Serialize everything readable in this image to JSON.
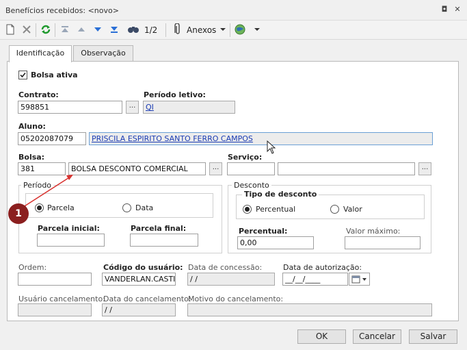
{
  "window": {
    "title": "Benefícios recebidos: <novo>",
    "controls": {
      "restore": "◘",
      "close": "✕"
    }
  },
  "toolbar": {
    "record_position": "1/2",
    "attachments_label": "Anexos"
  },
  "tabs": [
    {
      "label": "Identificação"
    },
    {
      "label": "Observação"
    }
  ],
  "form": {
    "bolsa_ativa_label": "Bolsa ativa",
    "contrato": {
      "label": "Contrato:",
      "value": "598851"
    },
    "periodo_letivo": {
      "label": "Período letivo:",
      "value": "QI"
    },
    "aluno": {
      "label": "Aluno:",
      "code": "05202087079",
      "name": "PRISCILA ESPIRITO SANTO FERRO CAMPOS"
    },
    "bolsa": {
      "label": "Bolsa:",
      "code": "381",
      "name": "BOLSA DESCONTO COMERCIAL"
    },
    "servico": {
      "label": "Serviço:",
      "code": "",
      "name": ""
    },
    "periodo_group": {
      "label": "Período",
      "option_parcela": "Parcela",
      "option_data": "Data",
      "parcela_inicial_label": "Parcela inicial:",
      "parcela_final_label": "Parcela final:",
      "parcela_inicial_value": "",
      "parcela_final_value": ""
    },
    "desconto_group": {
      "label": "Desconto",
      "tipo_label": "Tipo de desconto",
      "option_percentual": "Percentual",
      "option_valor": "Valor",
      "percentual_label": "Percentual:",
      "percentual_value": "0,00",
      "valor_maximo_label": "Valor máximo:",
      "valor_maximo_value": ""
    },
    "ordem": {
      "label": "Ordem:",
      "value": ""
    },
    "codigo_usuario": {
      "label": "Código do usuário:",
      "value": "VANDERLAN.CASTIC"
    },
    "data_concessao": {
      "label": "Data de concessão:",
      "value": " / /"
    },
    "data_autorizacao": {
      "label": "Data de autorização:",
      "value": "__/__/____"
    },
    "usuario_cancelamento": {
      "label": "Usuário cancelamento:",
      "value": ""
    },
    "data_cancelamento": {
      "label": "Data do cancelamento:",
      "value": " / /"
    },
    "motivo_cancelamento": {
      "label": "Motivo do cancelamento:",
      "value": ""
    }
  },
  "annotation": {
    "marker": "1"
  },
  "buttons": {
    "ok": "OK",
    "cancel": "Cancelar",
    "save": "Salvar"
  },
  "colors": {
    "accent_link": "#1a3bb3",
    "annotation_red": "#8b1f1f"
  }
}
